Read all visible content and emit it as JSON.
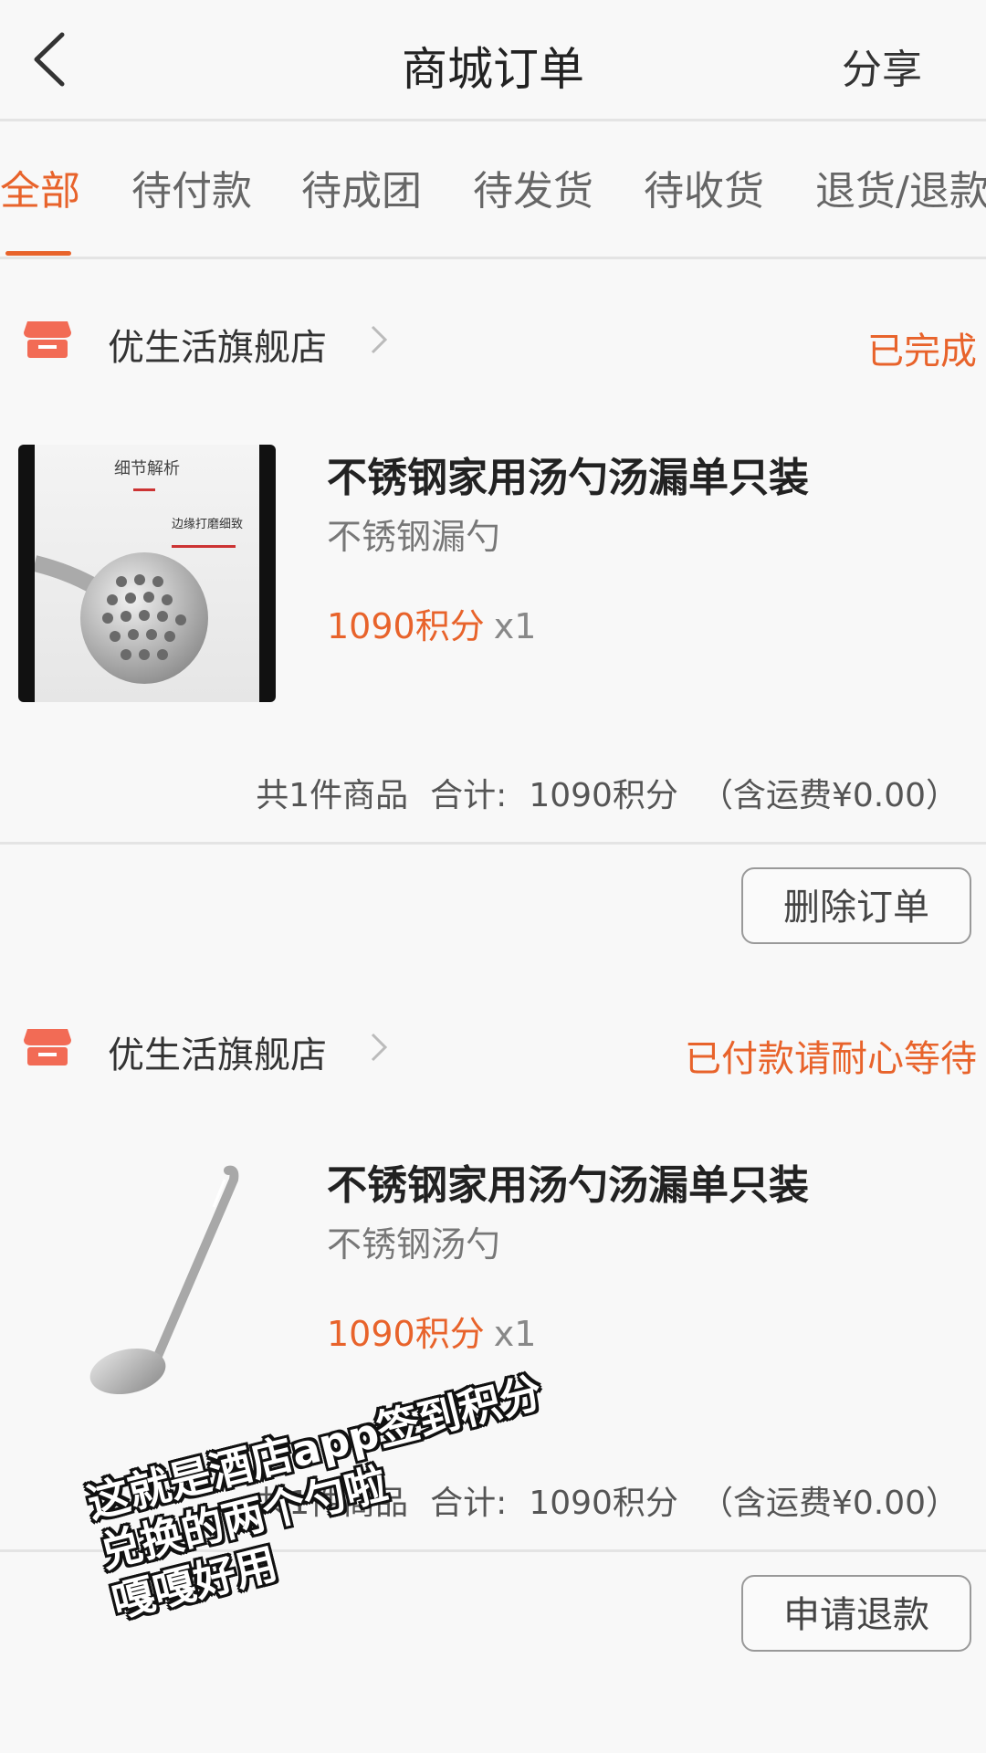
{
  "header": {
    "title": "商城订单",
    "share_label": "分享"
  },
  "tabs": [
    {
      "label": "全部",
      "active": true
    },
    {
      "label": "待付款"
    },
    {
      "label": "待成团"
    },
    {
      "label": "待发货"
    },
    {
      "label": "待收货"
    },
    {
      "label": "退货/退款"
    }
  ],
  "orders": [
    {
      "store_name": "优生活旗舰店",
      "status": "已完成",
      "product_title": "不锈钢家用汤勺汤漏单只装",
      "product_spec": "不锈钢漏勺",
      "price": "1090积分",
      "qty": "x1",
      "image_text": {
        "heading": "细节解析",
        "subheading": "边缘打磨细致"
      },
      "summary_count": "共1件商品",
      "summary_total_label": "合计:",
      "summary_total": "1090积分",
      "summary_shipping": "（含运费¥0.00）",
      "action_label": "删除订单"
    },
    {
      "store_name": "优生活旗舰店",
      "status": "已付款请耐心等待",
      "product_title": "不锈钢家用汤勺汤漏单只装",
      "product_spec": "不锈钢汤勺",
      "price": "1090积分",
      "qty": "x1",
      "summary_count": "共1件商品",
      "summary_total_label": "合计:",
      "summary_total": "1090积分",
      "summary_shipping": "（含运费¥0.00）",
      "action_label": "申请退款"
    }
  ],
  "overlay_text": [
    "这就是酒店app签到积分",
    "兑换的两个勺啦",
    "嘎嘎好用"
  ],
  "colors": {
    "accent": "#e8632b",
    "store_icon": "#f26b55"
  }
}
